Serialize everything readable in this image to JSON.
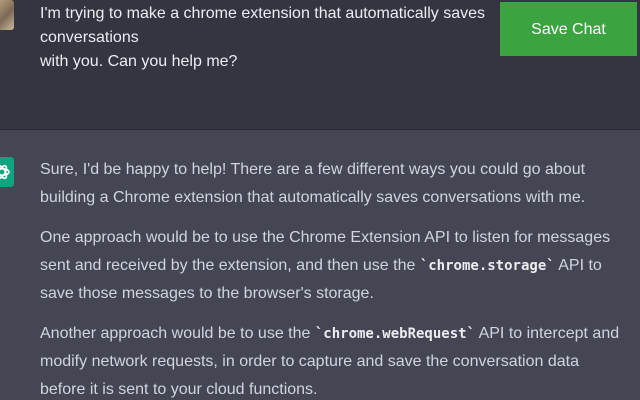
{
  "user_message": {
    "line1": "I'm trying to make a chrome extension that automatically saves conversations",
    "line2": "with you. Can you help me?"
  },
  "save_button": {
    "label": "Save Chat",
    "color": "#3ba33f"
  },
  "assistant_message": {
    "p1": "Sure, I'd be happy to help! There are a few different ways you could go about building a Chrome extension that automatically saves conversations with me.",
    "p2_a": "One approach would be to use the Chrome Extension API to listen for messages sent and received by the extension, and then use the ",
    "p2_code": "`chrome.storage`",
    "p2_b": " API to save those messages to the browser's storage.",
    "p3_a": "Another approach would be to use the ",
    "p3_code": "`chrome.webRequest`",
    "p3_b": " API to intercept and modify network requests, in order to capture and save the conversation data before it is sent to your cloud functions."
  },
  "colors": {
    "user_bg": "#343541",
    "assistant_bg": "#444654",
    "assistant_icon": "#10a37f"
  },
  "icons": {
    "user_avatar": "user-avatar-photo",
    "assistant_avatar": "openai-logo-icon"
  }
}
